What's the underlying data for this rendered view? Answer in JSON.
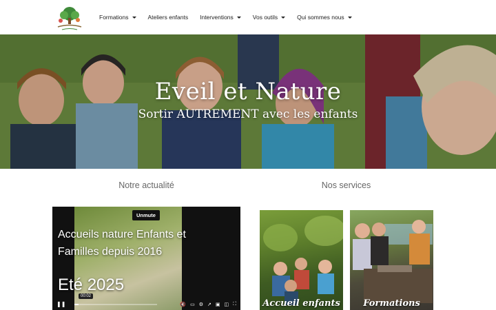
{
  "header": {
    "logo_text": "Éveil et Nature",
    "nav": [
      {
        "label": "Formations",
        "has_dropdown": true
      },
      {
        "label": "Ateliers enfants",
        "has_dropdown": false
      },
      {
        "label": "Interventions",
        "has_dropdown": true
      },
      {
        "label": "Vos outils",
        "has_dropdown": true
      },
      {
        "label": "Qui sommes nous",
        "has_dropdown": true
      }
    ]
  },
  "hero": {
    "title": "Eveil et Nature",
    "subtitle": "Sortir AUTREMENT avec les enfants"
  },
  "news": {
    "heading": "Notre actualité",
    "video": {
      "unmute_label": "Unmute",
      "line1": "Accueils nature Enfants et",
      "line2": "Familles depuis 2016",
      "big_text": "Eté 2025",
      "time": "00:02",
      "progress": 0.05
    }
  },
  "services": {
    "heading": "Nos services",
    "cards": [
      {
        "label": "Accueil enfants"
      },
      {
        "label": "Formations"
      }
    ]
  },
  "colors": {
    "nav_text": "#222222",
    "section_heading": "#666666",
    "hero_text": "#ffffff"
  }
}
